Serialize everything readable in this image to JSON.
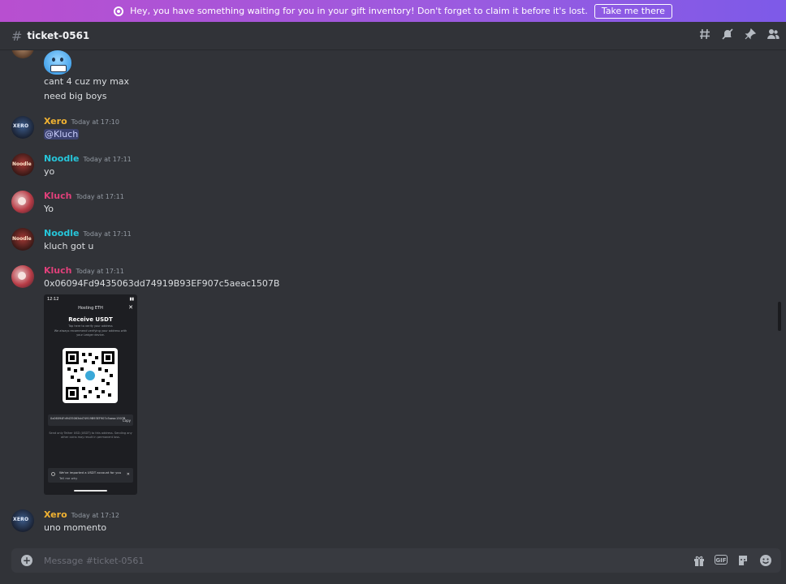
{
  "banner": {
    "text": "Hey, you have something waiting for you in your gift inventory! Don't forget to claim it before it's lost.",
    "button": "Take me there",
    "icon": "nitro-gift-icon"
  },
  "header": {
    "hash": "#",
    "channel": "ticket-0561",
    "tools": [
      "threads-icon",
      "mute-icon",
      "pin-icon",
      "members-icon"
    ]
  },
  "messages": [
    {
      "cont1": "cant 4 cuz my max",
      "cont2": "need big boys"
    },
    {
      "user": "Xero",
      "time": "Today at 17:10",
      "text": "@Kluch"
    },
    {
      "user": "Noodle",
      "time": "Today at 17:11",
      "text": "yo"
    },
    {
      "user": "Kluch",
      "time": "Today at 17:11",
      "text": "Yo"
    },
    {
      "user": "Noodle",
      "time": "Today at 17:11",
      "text": "kluch got u"
    },
    {
      "user": "Kluch",
      "time": "Today at 17:11",
      "text": "0x06094Fd9435063dd74919B93EF907c5aeac1507B"
    },
    {
      "user": "Xero",
      "time": "Today at 17:12",
      "text": "uno momento"
    }
  ],
  "attachment": {
    "status_time": "12:12",
    "header": "Hosting ETH",
    "close": "✕",
    "title": "Receive USDT",
    "sub1": "Tap here to verify your address",
    "sub2": "We always recommend verifying your address with your Ledger device.",
    "address": "0x06094Fd9435063dd74919B93EF907c5aeac1507B",
    "copy": "Copy",
    "warning": "Send only Tether USD (USDT) to this address. Sending any other coins may result in permanent loss.",
    "notice1": "We've imported a USDT account for you",
    "notice2": "Tell me why"
  },
  "input": {
    "placeholder": "Message #ticket-0561",
    "plus": "+",
    "gif": "GIF",
    "tools": [
      "gift-icon",
      "gif-icon",
      "sticker-icon",
      "emoji-icon"
    ]
  },
  "colors": {
    "xero": "#f0b232",
    "noodle": "#26c6da",
    "kluch": "#e0407a",
    "background": "#313338"
  }
}
